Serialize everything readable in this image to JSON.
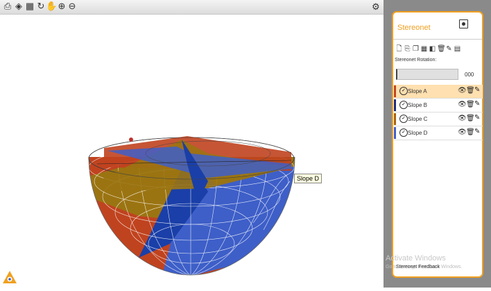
{
  "toolbar": {
    "buttons": [
      {
        "icon": "print-icon",
        "glyph": "⎙"
      },
      {
        "icon": "cube-icon",
        "glyph": "◈"
      },
      {
        "icon": "export-icon",
        "glyph": "▦"
      },
      {
        "icon": "rotate-icon",
        "glyph": "↻"
      },
      {
        "icon": "pan-hand-icon",
        "glyph": "✋"
      },
      {
        "icon": "zoom-in-icon",
        "glyph": "⊕"
      },
      {
        "icon": "zoom-out-icon",
        "glyph": "⊖"
      }
    ],
    "settings_icon": "gear-icon"
  },
  "viewport": {
    "tooltip": "Slope D"
  },
  "panel": {
    "title": "Stereonet",
    "tools": [
      "new-file-icon",
      "copy-icon",
      "paste-icon",
      "grid-icon",
      "split-icon",
      "delete-icon",
      "edit-icon",
      "calculator-icon"
    ],
    "rotation_label": "Stereonet Rotation:",
    "rotation_value": "000",
    "slopes": [
      {
        "name": "Slope A",
        "color": "#c0431f",
        "selected": true
      },
      {
        "name": "Slope B",
        "color": "#1a2c7a",
        "selected": false
      },
      {
        "name": "Slope C",
        "color": "#a8620a",
        "selected": false
      },
      {
        "name": "Slope D",
        "color": "#3e5fc8",
        "selected": false
      }
    ],
    "feedback": "Stereonet Feedback"
  },
  "watermark": {
    "line1": "Activate Windows",
    "line2": "Go to Settings to activate Windows."
  },
  "colors": {
    "accent": "#f0a020",
    "slope_a": "#c0431f",
    "slope_c": "#9b7412",
    "slope_d": "#3e5fc8",
    "slope_b": "#1a3fa8"
  }
}
